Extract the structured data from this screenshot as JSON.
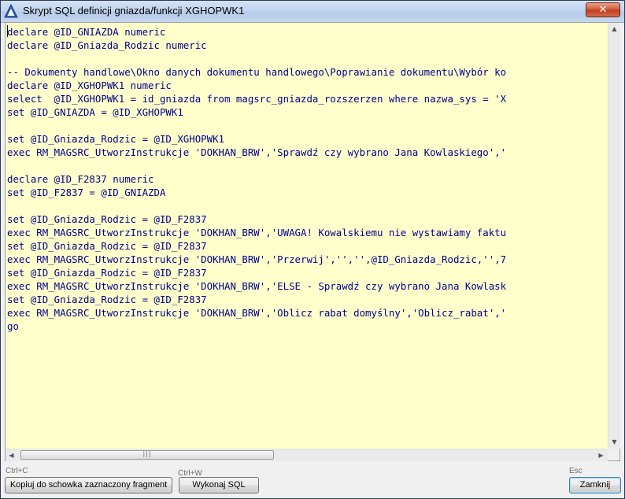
{
  "window": {
    "title": "Skrypt SQL definicji gniazda/funkcji XGHOPWK1",
    "close_glyph": "✕"
  },
  "editor": {
    "lines": [
      "declare @ID_GNIAZDA numeric",
      "declare @ID_Gniazda_Rodzic numeric",
      "",
      "-- Dokumenty handlowe\\Okno danych dokumentu handlowego\\Poprawianie dokumentu\\Wybór ko",
      "declare @ID_XGHOPWK1 numeric",
      "select  @ID_XGHOPWK1 = id_gniazda from magsrc_gniazda_rozszerzen where nazwa_sys = 'X",
      "set @ID_GNIAZDA = @ID_XGHOPWK1",
      "",
      "set @ID_Gniazda_Rodzic = @ID_XGHOPWK1",
      "exec RM_MAGSRC_UtworzInstrukcje 'DOKHAN_BRW','Sprawdź czy wybrano Jana Kowlaskiego','",
      "",
      "declare @ID_F2837 numeric",
      "set @ID_F2837 = @ID_GNIAZDA",
      "",
      "set @ID_Gniazda_Rodzic = @ID_F2837",
      "exec RM_MAGSRC_UtworzInstrukcje 'DOKHAN_BRW','UWAGA! Kowalskiemu nie wystawiamy faktu",
      "set @ID_Gniazda_Rodzic = @ID_F2837",
      "exec RM_MAGSRC_UtworzInstrukcje 'DOKHAN_BRW','Przerwij','','',@ID_Gniazda_Rodzic,'',7",
      "set @ID_Gniazda_Rodzic = @ID_F2837",
      "exec RM_MAGSRC_UtworzInstrukcje 'DOKHAN_BRW','ELSE - Sprawdź czy wybrano Jana Kowlask",
      "set @ID_Gniazda_Rodzic = @ID_F2837",
      "exec RM_MAGSRC_UtworzInstrukcje 'DOKHAN_BRW','Oblicz rabat domyślny','Oblicz_rabat','",
      "go"
    ]
  },
  "scrollbars": {
    "up_arrow": "▲",
    "down_arrow": "▼",
    "left_arrow": "◀",
    "right_arrow": "▶",
    "thumb_grip": "|||"
  },
  "footer": {
    "copy": {
      "shortcut": "Ctrl+C",
      "label": "Kopiuj do schowka zaznaczony fragment"
    },
    "execute": {
      "shortcut": "Ctrl+W",
      "label": "Wykonaj SQL"
    },
    "close": {
      "shortcut": "Esc",
      "label": "Zamknij"
    }
  },
  "colors": {
    "editor_background": "#ffffcc",
    "code_text": "#00008b",
    "titlebar": "#c2d6ee",
    "close_button": "#c23c1e"
  },
  "icons": {
    "app_icon": "triangle-warning-icon",
    "close": "close-icon"
  }
}
